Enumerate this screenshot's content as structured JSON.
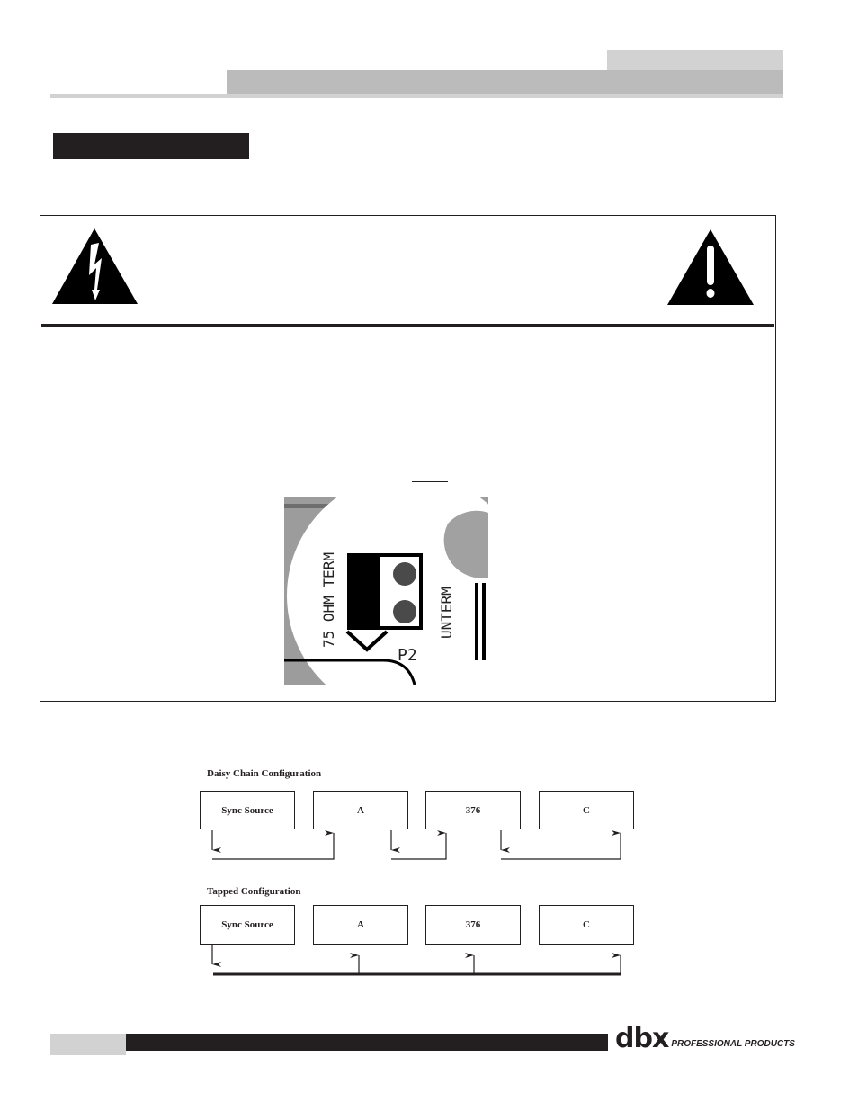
{
  "header": {
    "tab_color": "#d2d2d2",
    "bar_color": "#bbbbbb",
    "section_label_color": "#231f20"
  },
  "warning": {
    "left_icon": "electric-shock-warning-icon",
    "right_icon": "exclamation-caution-icon"
  },
  "jumper": {
    "label_left": "75 OHM TERM",
    "label_right": "UNTERM",
    "label_ref": "P2"
  },
  "diagrams": {
    "daisy_chain": {
      "title": "Daisy Chain Configuration",
      "nodes": [
        "Sync Source",
        "A",
        "376",
        "C"
      ]
    },
    "tapped": {
      "title": "Tapped Configuration",
      "nodes": [
        "Sync Source",
        "A",
        "376",
        "C"
      ]
    }
  },
  "footer": {
    "logo_main": "dbx",
    "logo_sub": "PROFESSIONAL PRODUCTS"
  }
}
